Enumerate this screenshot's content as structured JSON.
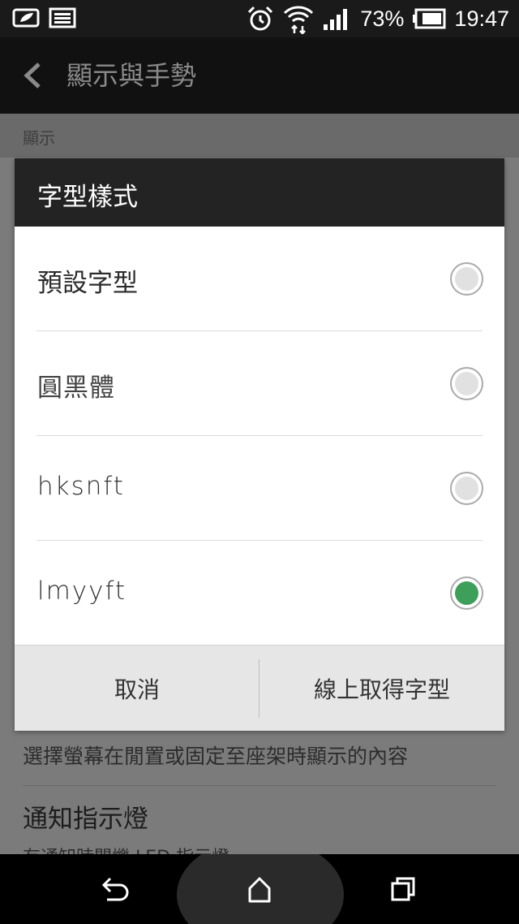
{
  "status_bar": {
    "battery_percent": "73%",
    "time": "19:47",
    "left_icons": [
      "notification-mail-icon",
      "image-icon"
    ],
    "right_icons": [
      "alarm-icon",
      "wifi-icon",
      "signal-icon",
      "battery-icon"
    ]
  },
  "action_bar": {
    "back_icon": "chevron-left-icon",
    "title": "顯示與手勢"
  },
  "background_page": {
    "section_header": "顯示",
    "item_description": "選擇螢幕在閒置或固定至座架時顯示的內容",
    "item_title": "通知指示燈",
    "item_subtitle": "有通知時閃爍 LED 指示燈"
  },
  "dialog": {
    "title": "字型樣式",
    "options": [
      {
        "label": "預設字型",
        "checked": false
      },
      {
        "label": "圓黑體",
        "checked": false
      },
      {
        "label": "hksnft",
        "checked": false
      },
      {
        "label": "lmyyft",
        "checked": true
      }
    ],
    "cancel_label": "取消",
    "online_label": "線上取得字型",
    "accent_color": "#3e9f5a"
  },
  "nav_bar": {
    "icons": [
      "back-icon",
      "home-icon",
      "recents-icon"
    ]
  }
}
